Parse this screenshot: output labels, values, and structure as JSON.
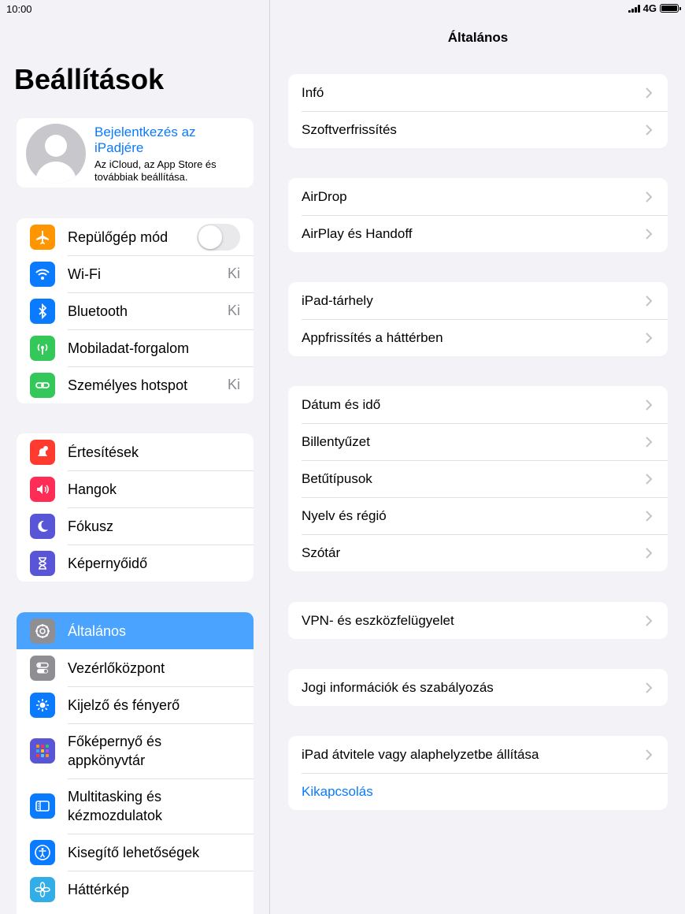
{
  "status": {
    "time": "10:00",
    "network": "4G"
  },
  "sidebar": {
    "title": "Beállítások",
    "profile": {
      "link": "Bejelentkezés az iPadjére",
      "subtitle": "Az iCloud, az App Store és továbbiak beállítása."
    },
    "group1": [
      {
        "label": "Repülőgép mód",
        "icon": "airplane-icon",
        "color": "#ff9500"
      },
      {
        "label": "Wi-Fi",
        "value": "Ki",
        "icon": "wifi-icon",
        "color": "#0a7aff"
      },
      {
        "label": "Bluetooth",
        "value": "Ki",
        "icon": "bluetooth-icon",
        "color": "#0a7aff"
      },
      {
        "label": "Mobiladat-forgalom",
        "icon": "antenna-icon",
        "color": "#34c759"
      },
      {
        "label": "Személyes hotspot",
        "value": "Ki",
        "icon": "hotspot-icon",
        "color": "#34c759"
      }
    ],
    "group2": [
      {
        "label": "Értesítések",
        "icon": "bell-icon",
        "color": "#ff3b30"
      },
      {
        "label": "Hangok",
        "icon": "speaker-icon",
        "color": "#ff2d55"
      },
      {
        "label": "Fókusz",
        "icon": "moon-icon",
        "color": "#5856d6"
      },
      {
        "label": "Képernyőidő",
        "icon": "hourglass-icon",
        "color": "#5856d6"
      }
    ],
    "group3": [
      {
        "label": "Általános",
        "icon": "gear-icon",
        "color": "#8e8e93"
      },
      {
        "label": "Vezérlőközpont",
        "icon": "switches-icon",
        "color": "#8e8e93"
      },
      {
        "label": "Kijelző és fényerő",
        "icon": "sun-icon",
        "color": "#0a7aff"
      },
      {
        "label": "Főképernyő és appkönyvtár",
        "icon": "grid-icon",
        "color": "#5856d6"
      },
      {
        "label": "Multitasking és kézmozdulatok",
        "icon": "multitask-icon",
        "color": "#0a7aff"
      },
      {
        "label": "Kisegítő lehetőségek",
        "icon": "accessibility-icon",
        "color": "#0a7aff"
      },
      {
        "label": "Háttérkép",
        "icon": "flower-icon",
        "color": "#32ade6"
      }
    ]
  },
  "main": {
    "title": "Általános",
    "groups": [
      [
        "Infó",
        "Szoftverfrissítés"
      ],
      [
        "AirDrop",
        "AirPlay és Handoff"
      ],
      [
        "iPad-tárhely",
        "Appfrissítés a háttérben"
      ],
      [
        "Dátum és idő",
        "Billentyűzet",
        "Betűtípusok",
        "Nyelv és régió",
        "Szótár"
      ],
      [
        "VPN- és eszközfelügyelet"
      ],
      [
        "Jogi információk és szabályozás"
      ],
      [
        "iPad átvitele vagy alaphelyzetbe állítása",
        "Kikapcsolás"
      ]
    ]
  }
}
